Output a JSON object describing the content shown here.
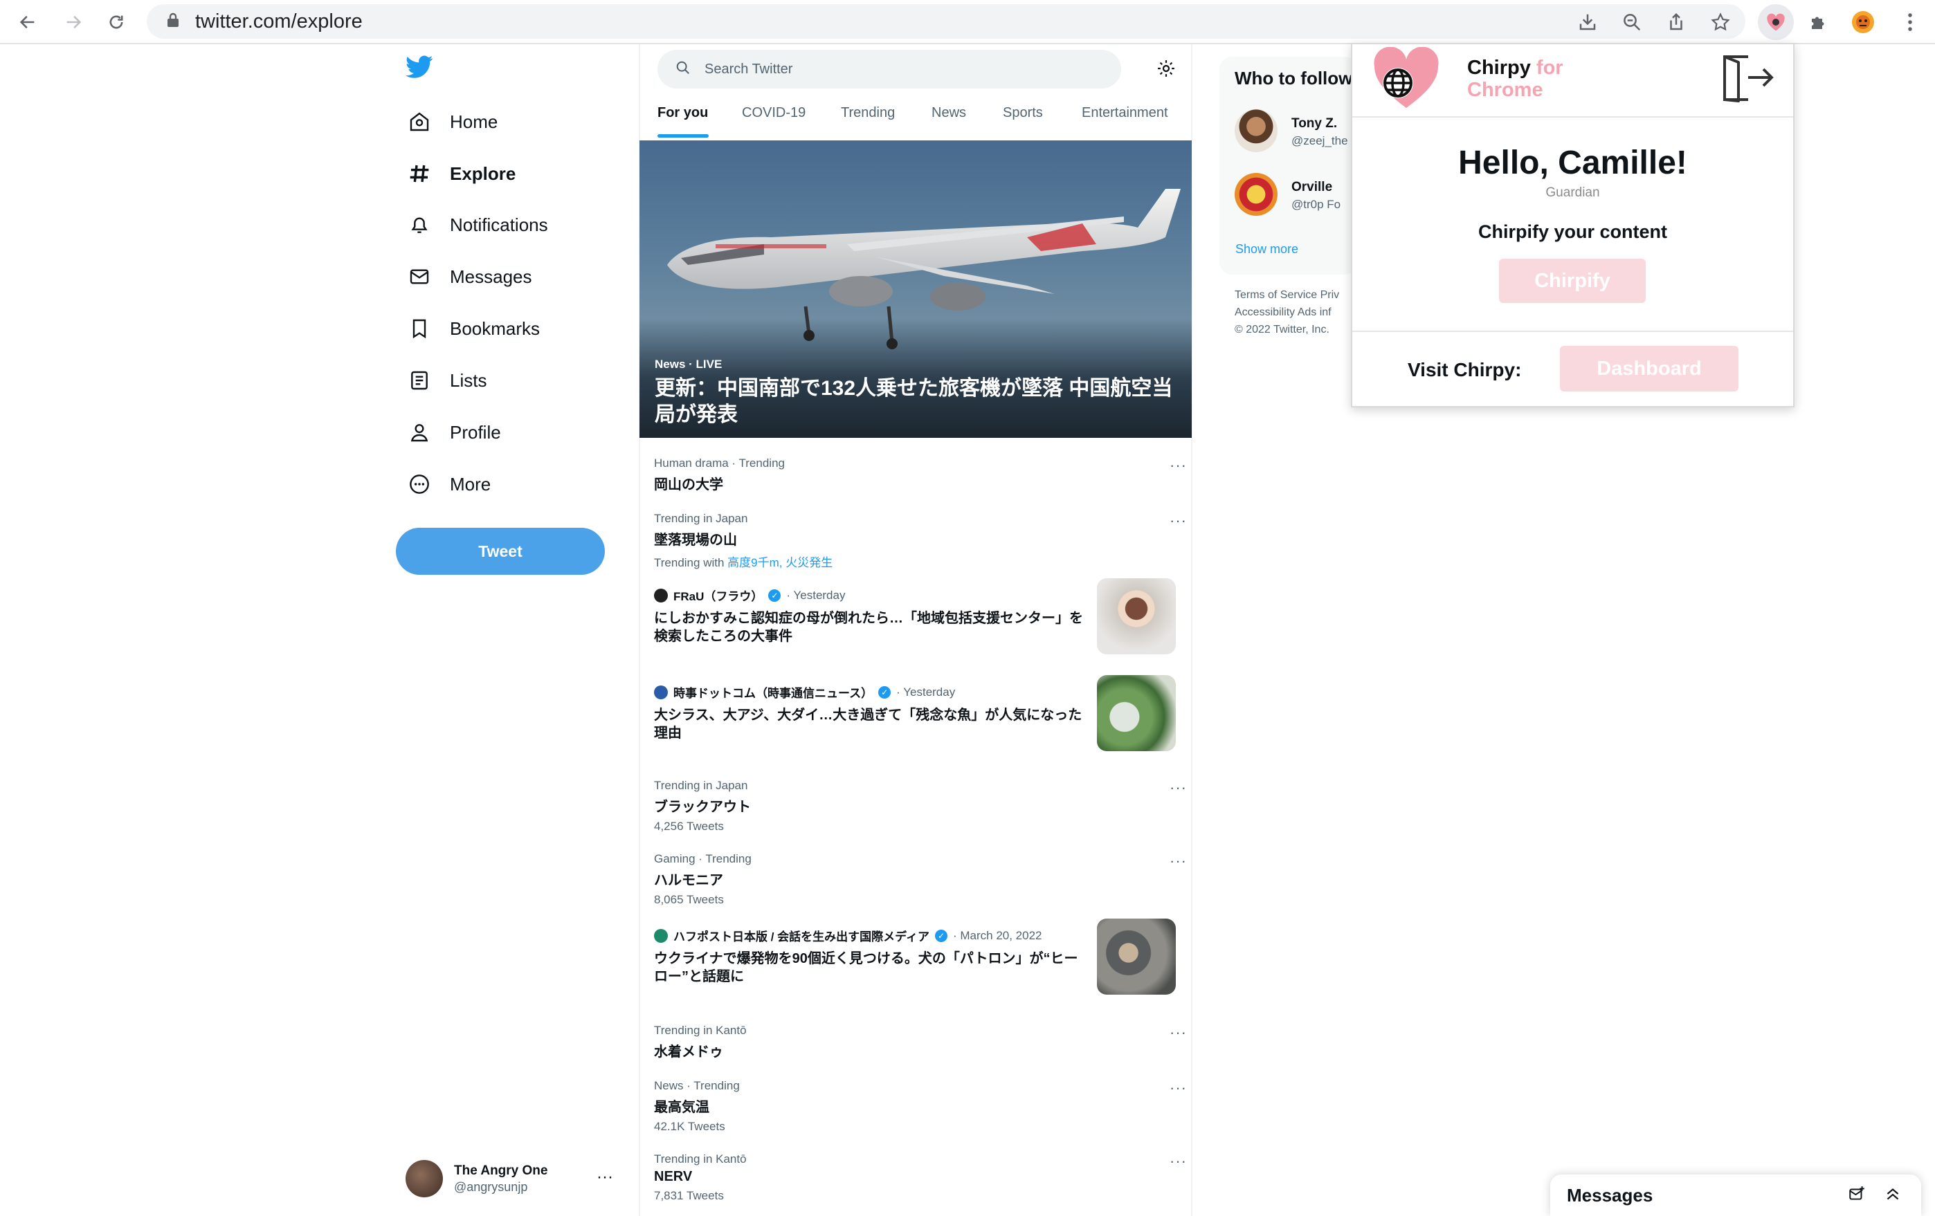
{
  "browser": {
    "url": "twitter.com/explore",
    "icons": [
      "back-icon",
      "forward-icon",
      "reload-icon",
      "lock-icon",
      "install-icon",
      "zoom-icon",
      "share-icon",
      "bookmark-star-icon",
      "chirpy-extension-icon",
      "extensions-puzzle-icon",
      "profile-avatar",
      "kebab-menu-icon"
    ]
  },
  "sidebar": {
    "items": [
      {
        "label": "Home",
        "icon": "home-icon"
      },
      {
        "label": "Explore",
        "icon": "hashtag-icon"
      },
      {
        "label": "Notifications",
        "icon": "bell-icon"
      },
      {
        "label": "Messages",
        "icon": "envelope-icon"
      },
      {
        "label": "Bookmarks",
        "icon": "bookmark-icon"
      },
      {
        "label": "Lists",
        "icon": "lists-icon"
      },
      {
        "label": "Profile",
        "icon": "person-icon"
      },
      {
        "label": "More",
        "icon": "more-circle-icon"
      }
    ],
    "tweet_label": "Tweet"
  },
  "account": {
    "name": "The Angry One",
    "handle": "@angrysunjp",
    "more": "···"
  },
  "search": {
    "placeholder": "Search Twitter"
  },
  "tabs": [
    "For you",
    "COVID-19",
    "Trending",
    "News",
    "Sports",
    "Entertainment"
  ],
  "hero": {
    "meta": "News · LIVE",
    "title": "更新：中国南部で132人乗せた旅客機が墜落 中国航空当局が発表"
  },
  "trends": [
    {
      "context": "Human drama · Trending",
      "name": "岡山の大学",
      "sub": ""
    },
    {
      "context": "Trending in Japan",
      "name": "墜落現場の山",
      "sub_prefix": "Trending with",
      "sub_links": "高度9千m, 火災発生"
    },
    {
      "context": "Trending in Japan",
      "name": "ブラックアウト",
      "sub": "4,256 Tweets"
    },
    {
      "context": "Gaming · Trending",
      "name": "ハルモニア",
      "sub": "8,065 Tweets"
    },
    {
      "context": "Trending in Kantō",
      "name": "水着メドゥ",
      "sub": ""
    },
    {
      "context": "News · Trending",
      "name": "最高気温",
      "sub": "42.1K Tweets"
    },
    {
      "context": "Trending in Kantō",
      "name": "NERV",
      "sub": "7,831 Tweets"
    }
  ],
  "news": [
    {
      "source": "FRaU（フラウ）",
      "time": "· Yesterday",
      "headline": "にしおかすみこ認知症の母が倒れたら…「地域包括支援センター」を検索したころの大事件"
    },
    {
      "source": "時事ドットコム（時事通信ニュース）",
      "time": "· Yesterday",
      "headline": "大シラス、大アジ、大ダイ…大き過ぎて「残念な魚」が人気になった理由"
    },
    {
      "source": "ハフポスト日本版 / 会話を生み出す国際メディア",
      "time": "· March 20, 2022",
      "headline": "ウクライナで爆発物を90個近く見つける。犬の「パトロン」が“ヒーロー”と話題に"
    }
  ],
  "who_to_follow": {
    "title": "Who to follow",
    "users": [
      {
        "name": "Tony Z.",
        "handle": "@zeej_the"
      },
      {
        "name": "Orville",
        "handle": "@tr0p  Fo"
      }
    ],
    "show_more": "Show more"
  },
  "footer": {
    "line1": "Terms of Service   Priv",
    "line2": "Accessibility   Ads inf",
    "line3": "© 2022 Twitter, Inc."
  },
  "messages_drawer": {
    "title": "Messages"
  },
  "extension": {
    "brand_name": "Chirpy",
    "brand_suffix_1": "for",
    "brand_suffix_2": "Chrome",
    "greeting": "Hello, Camille!",
    "role": "Guardian",
    "prompt": "Chirpify your content",
    "chirpify_label": "Chirpify",
    "visit_label": "Visit Chirpy:",
    "dashboard_label": "Dashboard",
    "accent_color": "#f5a4b2"
  },
  "colors": {
    "twitter_blue": "#1d9bf0",
    "tweet_button": "#4ba2e8"
  }
}
